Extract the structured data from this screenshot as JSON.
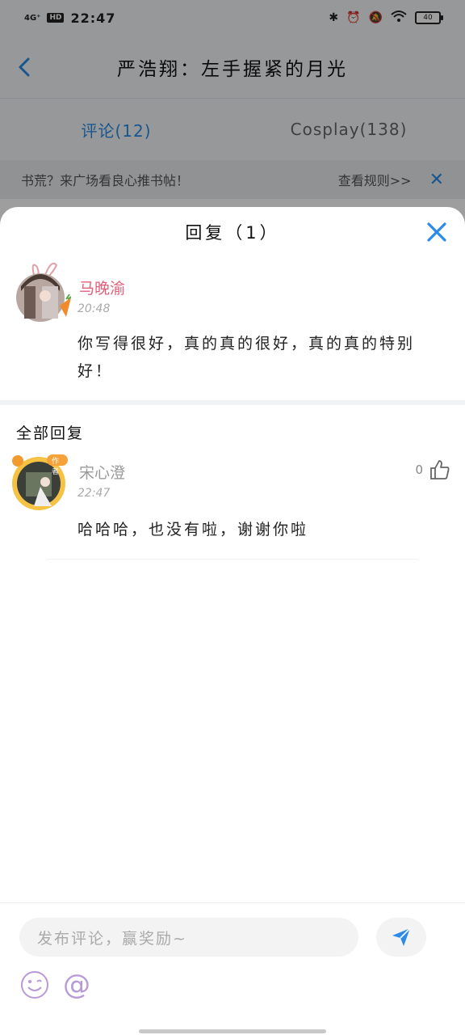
{
  "status_bar": {
    "signal": "4G⁺",
    "hd": "HD",
    "time": "22:47",
    "battery": "40"
  },
  "appbar": {
    "title": "严浩翔：左手握紧的月光"
  },
  "tabs": [
    {
      "label": "评论(12)",
      "active": true
    },
    {
      "label": "Cosplay(138)",
      "active": false
    }
  ],
  "notice": {
    "text": "书荒？来广场看良心推书帖！",
    "rule_link": "查看规则>>"
  },
  "sheet": {
    "title": "回复（1）",
    "original": {
      "name": "马晚渝",
      "time": "20:48",
      "text": "你写得很好，真的真的很好，真的真的特别好！"
    },
    "section_title": "全部回复",
    "replies": [
      {
        "name": "宋心澄",
        "time": "22:47",
        "text": "哈哈哈，也没有啦，谢谢你啦",
        "likes": "0",
        "badge": "作者"
      }
    ]
  },
  "composer": {
    "placeholder": "发布评论，赢奖励~"
  },
  "colors": {
    "accent": "#2b8be6",
    "name_pink": "#e0607a",
    "tool_purple": "#b89ad6"
  }
}
